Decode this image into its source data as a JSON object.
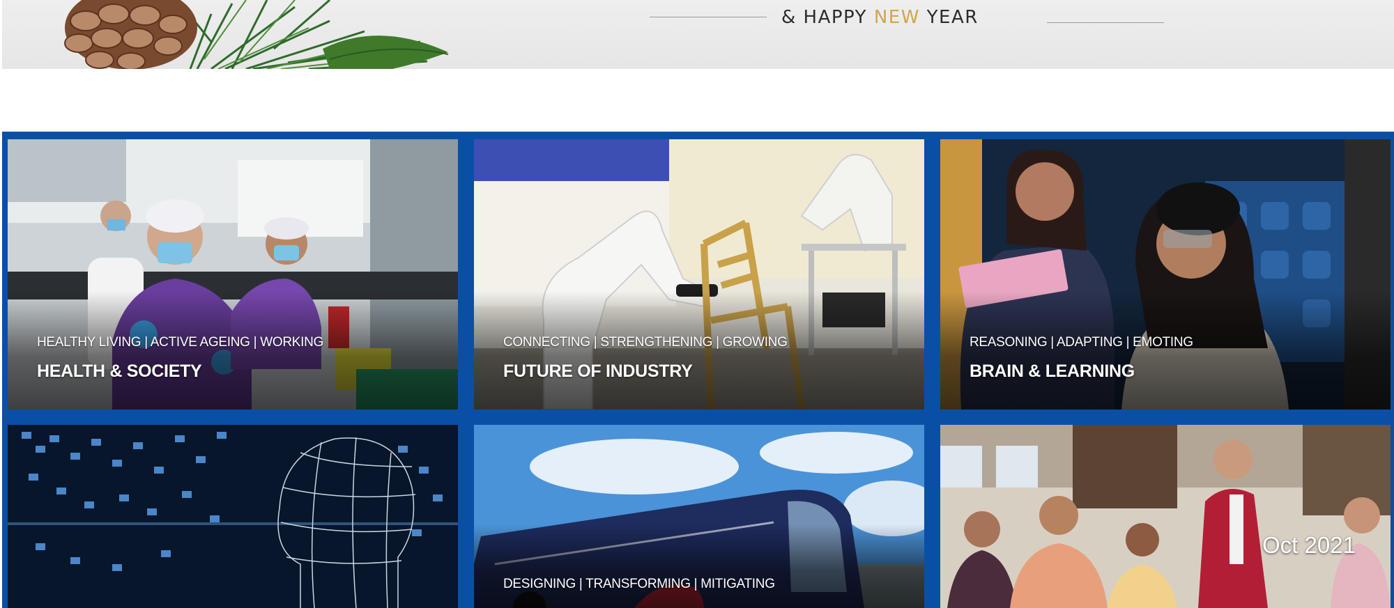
{
  "banner": {
    "prefix": "& HAPPY ",
    "highlight": "NEW",
    "suffix": " YEAR",
    "highlight_color": "#d3a44c"
  },
  "tiles": [
    {
      "subtitle": "HEALTHY LIVING | ACTIVE AGEING | WORKING",
      "title": "HEALTH & SOCIETY"
    },
    {
      "subtitle": "CONNECTING | STRENGTHENING | GROWING",
      "title": "FUTURE OF INDUSTRY"
    },
    {
      "subtitle": "REASONING | ADAPTING | EMOTING",
      "title": "BRAIN & LEARNING"
    },
    {
      "subtitle": "",
      "title": ""
    },
    {
      "subtitle": "DESIGNING | TRANSFORMING | MITIGATING",
      "title": ""
    },
    {
      "subtitle": "",
      "title": ""
    }
  ],
  "date_label": "Oct 2021",
  "colors": {
    "grid_blue": "#0a4fa6"
  }
}
